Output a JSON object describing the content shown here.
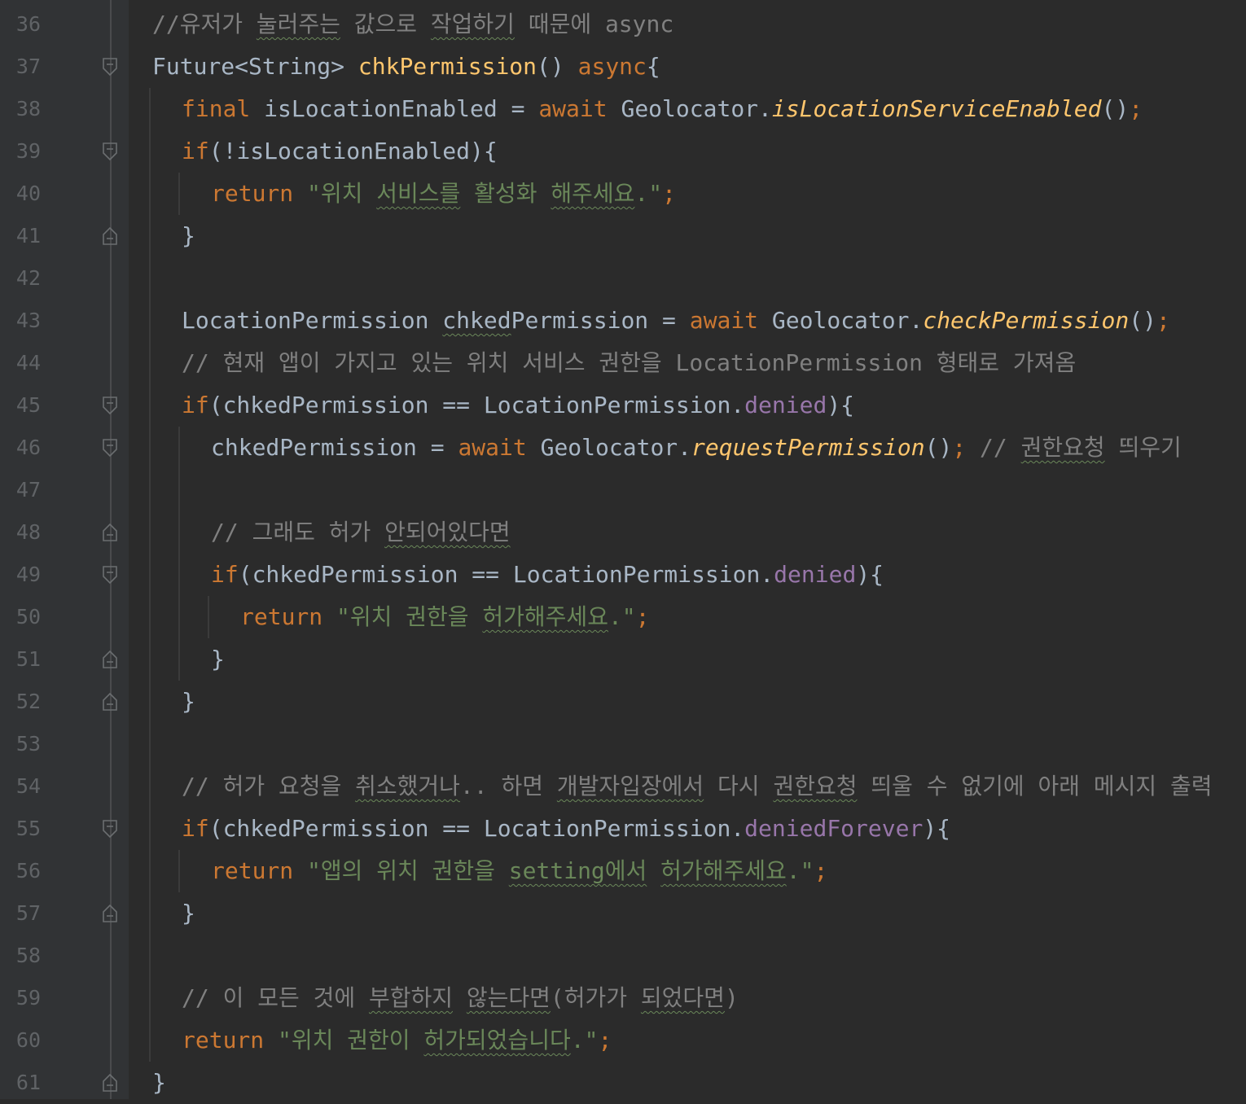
{
  "editor": {
    "lines": [
      {
        "no": "36",
        "indent": 0,
        "fold": "none",
        "tokens": [
          {
            "t": "//유저가 ",
            "c": "cmt"
          },
          {
            "t": "눌러주는",
            "c": "cmt",
            "u": true
          },
          {
            "t": " 값으로 ",
            "c": "cmt"
          },
          {
            "t": "작업하기",
            "c": "cmt",
            "u": true
          },
          {
            "t": " 때문에 async",
            "c": "cmt"
          }
        ]
      },
      {
        "no": "37",
        "indent": 0,
        "fold": "open",
        "tokens": [
          {
            "t": "Future<String> ",
            "c": "plain"
          },
          {
            "t": "chkPermission",
            "c": "fn"
          },
          {
            "t": "() ",
            "c": "plain"
          },
          {
            "t": "async",
            "c": "kw"
          },
          {
            "t": "{",
            "c": "plain"
          }
        ]
      },
      {
        "no": "38",
        "indent": 1,
        "fold": "none",
        "tokens": [
          {
            "t": "final ",
            "c": "kw"
          },
          {
            "t": "isLocationEnabled = ",
            "c": "plain"
          },
          {
            "t": "await ",
            "c": "kw"
          },
          {
            "t": "Geolocator.",
            "c": "plain"
          },
          {
            "t": "isLocationServiceEnabled",
            "c": "static"
          },
          {
            "t": "()",
            "c": "plain"
          },
          {
            "t": ";",
            "c": "punct"
          }
        ]
      },
      {
        "no": "39",
        "indent": 1,
        "fold": "open",
        "tokens": [
          {
            "t": "if",
            "c": "kw"
          },
          {
            "t": "(!isLocationEnabled){",
            "c": "plain"
          }
        ]
      },
      {
        "no": "40",
        "indent": 2,
        "fold": "none",
        "tokens": [
          {
            "t": "return ",
            "c": "kw"
          },
          {
            "t": "\"위치 ",
            "c": "str"
          },
          {
            "t": "서비스를",
            "c": "str",
            "u": true
          },
          {
            "t": " 활성화 ",
            "c": "str"
          },
          {
            "t": "해주세요",
            "c": "str",
            "u": true
          },
          {
            "t": ".\"",
            "c": "str"
          },
          {
            "t": ";",
            "c": "punct"
          }
        ]
      },
      {
        "no": "41",
        "indent": 1,
        "fold": "close",
        "tokens": [
          {
            "t": "}",
            "c": "plain"
          }
        ]
      },
      {
        "no": "42",
        "indent": 1,
        "fold": "none",
        "tokens": []
      },
      {
        "no": "43",
        "indent": 1,
        "fold": "none",
        "tokens": [
          {
            "t": "LocationPermission ",
            "c": "plain"
          },
          {
            "t": "chked",
            "c": "plain",
            "u": true
          },
          {
            "t": "Permission = ",
            "c": "plain"
          },
          {
            "t": "await ",
            "c": "kw"
          },
          {
            "t": "Geolocator.",
            "c": "plain"
          },
          {
            "t": "checkPermission",
            "c": "static"
          },
          {
            "t": "()",
            "c": "plain"
          },
          {
            "t": ";",
            "c": "punct"
          }
        ]
      },
      {
        "no": "44",
        "indent": 1,
        "fold": "none",
        "tokens": [
          {
            "t": "// 현재 앱이 가지고 있는 위치 서비스 권한을 LocationPermission 형태로 가져옴",
            "c": "cmt"
          }
        ]
      },
      {
        "no": "45",
        "indent": 1,
        "fold": "open",
        "tokens": [
          {
            "t": "if",
            "c": "kw"
          },
          {
            "t": "(chkedPermission == LocationPermission.",
            "c": "plain"
          },
          {
            "t": "denied",
            "c": "field"
          },
          {
            "t": "){",
            "c": "plain"
          }
        ]
      },
      {
        "no": "46",
        "indent": 2,
        "fold": "open",
        "tokens": [
          {
            "t": "chkedPermission = ",
            "c": "plain"
          },
          {
            "t": "await ",
            "c": "kw"
          },
          {
            "t": "Geolocator.",
            "c": "plain"
          },
          {
            "t": "requestPermission",
            "c": "static"
          },
          {
            "t": "()",
            "c": "plain"
          },
          {
            "t": "; ",
            "c": "punct"
          },
          {
            "t": "// ",
            "c": "cmt"
          },
          {
            "t": "권한요청",
            "c": "cmt",
            "u": true
          },
          {
            "t": " 띄우기",
            "c": "cmt"
          }
        ]
      },
      {
        "no": "47",
        "indent": 2,
        "fold": "none",
        "tokens": []
      },
      {
        "no": "48",
        "indent": 2,
        "fold": "close",
        "tokens": [
          {
            "t": "// 그래도 허가 ",
            "c": "cmt"
          },
          {
            "t": "안되어있다면",
            "c": "cmt",
            "u": true
          }
        ]
      },
      {
        "no": "49",
        "indent": 2,
        "fold": "open",
        "tokens": [
          {
            "t": "if",
            "c": "kw"
          },
          {
            "t": "(chkedPermission == LocationPermission.",
            "c": "plain"
          },
          {
            "t": "denied",
            "c": "field"
          },
          {
            "t": "){",
            "c": "plain"
          }
        ]
      },
      {
        "no": "50",
        "indent": 3,
        "fold": "none",
        "tokens": [
          {
            "t": "return ",
            "c": "kw"
          },
          {
            "t": "\"위치 권한을 ",
            "c": "str"
          },
          {
            "t": "허가해주세요",
            "c": "str",
            "u": true
          },
          {
            "t": ".\"",
            "c": "str"
          },
          {
            "t": ";",
            "c": "punct"
          }
        ]
      },
      {
        "no": "51",
        "indent": 2,
        "fold": "close",
        "tokens": [
          {
            "t": "}",
            "c": "plain"
          }
        ]
      },
      {
        "no": "52",
        "indent": 1,
        "fold": "close",
        "tokens": [
          {
            "t": "}",
            "c": "plain"
          }
        ]
      },
      {
        "no": "53",
        "indent": 1,
        "fold": "none",
        "tokens": []
      },
      {
        "no": "54",
        "indent": 1,
        "fold": "none",
        "tokens": [
          {
            "t": "// 허가 요청을 ",
            "c": "cmt"
          },
          {
            "t": "취소했거나",
            "c": "cmt",
            "u": true
          },
          {
            "t": ".. 하면 ",
            "c": "cmt"
          },
          {
            "t": "개발자입장에서",
            "c": "cmt",
            "u": true
          },
          {
            "t": " 다시 ",
            "c": "cmt"
          },
          {
            "t": "권한요청",
            "c": "cmt",
            "u": true
          },
          {
            "t": " 띄울 수 없기에 아래 메시지 출력",
            "c": "cmt"
          }
        ]
      },
      {
        "no": "55",
        "indent": 1,
        "fold": "open",
        "tokens": [
          {
            "t": "if",
            "c": "kw"
          },
          {
            "t": "(chkedPermission == LocationPermission.",
            "c": "plain"
          },
          {
            "t": "deniedForever",
            "c": "field"
          },
          {
            "t": "){",
            "c": "plain"
          }
        ]
      },
      {
        "no": "56",
        "indent": 2,
        "fold": "none",
        "tokens": [
          {
            "t": "return ",
            "c": "kw"
          },
          {
            "t": "\"앱의 위치 권한을 ",
            "c": "str"
          },
          {
            "t": "setting에서",
            "c": "str",
            "u": true
          },
          {
            "t": " ",
            "c": "str"
          },
          {
            "t": "허가해주세요",
            "c": "str",
            "u": true
          },
          {
            "t": ".\"",
            "c": "str"
          },
          {
            "t": ";",
            "c": "punct"
          }
        ]
      },
      {
        "no": "57",
        "indent": 1,
        "fold": "close",
        "tokens": [
          {
            "t": "}",
            "c": "plain"
          }
        ]
      },
      {
        "no": "58",
        "indent": 1,
        "fold": "none",
        "tokens": []
      },
      {
        "no": "59",
        "indent": 1,
        "fold": "none",
        "tokens": [
          {
            "t": "// 이 모든 것에 ",
            "c": "cmt"
          },
          {
            "t": "부합하지",
            "c": "cmt",
            "u": true
          },
          {
            "t": " ",
            "c": "cmt"
          },
          {
            "t": "않는다면",
            "c": "cmt",
            "u": true
          },
          {
            "t": "(허가가 ",
            "c": "cmt"
          },
          {
            "t": "되었다면",
            "c": "cmt",
            "u": true
          },
          {
            "t": ")",
            "c": "cmt"
          }
        ]
      },
      {
        "no": "60",
        "indent": 1,
        "fold": "none",
        "tokens": [
          {
            "t": "return ",
            "c": "kw"
          },
          {
            "t": "\"위치 권한이 ",
            "c": "str"
          },
          {
            "t": "허가되었습니다",
            "c": "str",
            "u": true
          },
          {
            "t": ".\"",
            "c": "str"
          },
          {
            "t": ";",
            "c": "punct"
          }
        ]
      },
      {
        "no": "61",
        "indent": 0,
        "fold": "close",
        "tokens": [
          {
            "t": "}",
            "c": "plain"
          }
        ]
      }
    ]
  },
  "colors": {
    "background": "#2b2b2b",
    "gutter": "#313335",
    "keyword": "#cc7832",
    "function": "#ffc66d",
    "string": "#6a8759",
    "field": "#9876aa",
    "comment": "#808080",
    "text": "#a9b7c6"
  },
  "icons": {
    "fold_open": "fold-open-icon",
    "fold_close": "fold-close-icon"
  }
}
